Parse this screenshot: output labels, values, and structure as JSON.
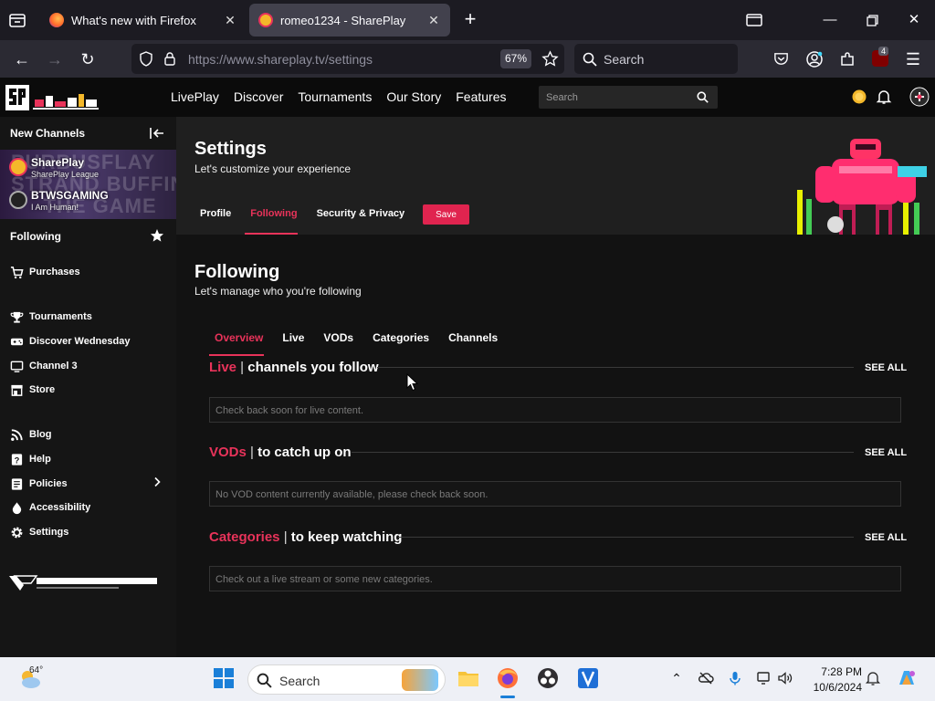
{
  "browser": {
    "tabs": [
      {
        "title": "What's new with Firefox"
      },
      {
        "title": "romeo1234 - SharePlay"
      }
    ],
    "url": "https://www.shareplay.tv/settings",
    "zoom": "67%",
    "search_placeholder": "Search",
    "extension_badge": "4"
  },
  "site": {
    "nav": [
      "LivePlay",
      "Discover",
      "Tournaments",
      "Our Story",
      "Features"
    ],
    "search_placeholder": "Search"
  },
  "sidebar": {
    "new_channels_label": "New Channels",
    "channels": [
      {
        "name": "SharePlay",
        "subtitle": "SharePlay League"
      },
      {
        "name": "BTWSGAMING",
        "subtitle": "I Am Human!"
      }
    ],
    "banner_text": "PURBUSFLAY\nSTRAND BUFFING\nTHE GAME",
    "following_label": "Following",
    "items_group1": [
      "Purchases"
    ],
    "items_group2": [
      "Tournaments",
      "Discover Wednesday",
      "Channel 3",
      "Store"
    ],
    "items_group3": [
      "Blog",
      "Help",
      "Policies",
      "Accessibility",
      "Settings"
    ]
  },
  "settings": {
    "title": "Settings",
    "subtitle": "Let's customize your experience",
    "tabs": [
      "Profile",
      "Following",
      "Security & Privacy"
    ],
    "active_tab": "Following",
    "save_label": "Save"
  },
  "following": {
    "title": "Following",
    "subtitle": "Let's manage who you're following",
    "tabs": [
      "Overview",
      "Live",
      "VODs",
      "Categories",
      "Channels"
    ],
    "active_tab": "Overview",
    "sections": [
      {
        "highlight": "Live",
        "rest": "channels you follow",
        "see_all": "SEE ALL",
        "empty": "Check back soon for live content."
      },
      {
        "highlight": "VODs",
        "rest": "to catch up on",
        "see_all": "SEE ALL",
        "empty": "No VOD content currently available, please check back soon."
      },
      {
        "highlight": "Categories",
        "rest": "to keep watching",
        "see_all": "SEE ALL",
        "empty": "Check out a live stream or some new categories."
      }
    ]
  },
  "taskbar": {
    "temperature": "64°",
    "search_label": "Search",
    "time": "7:28 PM",
    "date": "10/6/2024"
  },
  "colors": {
    "accent": "#e8335a",
    "save_button": "#e0244f"
  }
}
